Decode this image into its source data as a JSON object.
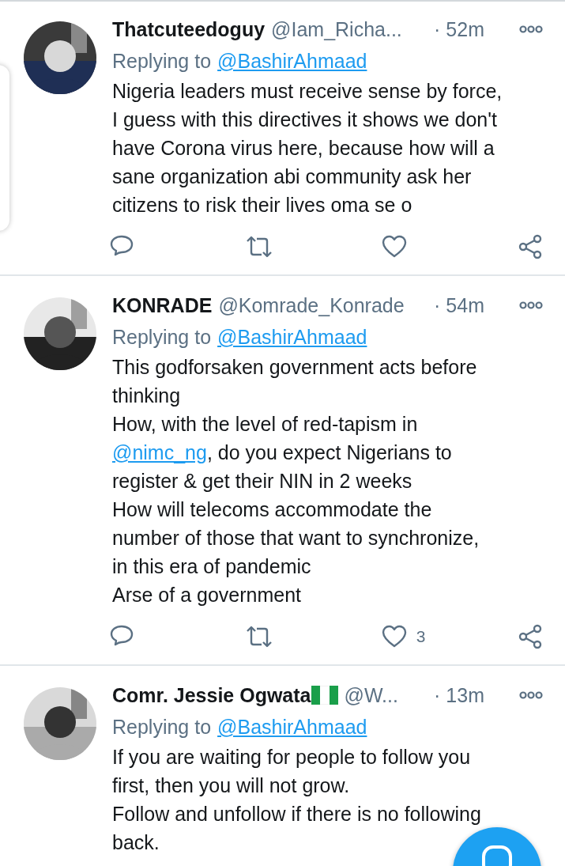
{
  "tweets": [
    {
      "name": "Thatcuteedoguy",
      "flag": false,
      "handle": "@Iam_Richa...",
      "time": "· 52m",
      "replying_label": "Replying to",
      "replying_to": "@BashirAhmaad",
      "lines": [
        [
          {
            "text": "Nigeria leaders must receive sense by force,",
            "link": false
          }
        ],
        [
          {
            "text": "I guess with this directives it shows we don't",
            "link": false
          }
        ],
        [
          {
            "text": "have Corona virus here, because how will a",
            "link": false
          }
        ],
        [
          {
            "text": "sane organization abi community ask her",
            "link": false
          }
        ],
        [
          {
            "text": "citizens to risk their lives oma se o",
            "link": false
          }
        ]
      ]
    },
    {
      "name": "KONRADE",
      "flag": false,
      "handle": "@Komrade_Konrade",
      "time": "· 54m",
      "replying_label": "Replying to",
      "replying_to": "@BashirAhmaad",
      "lines": [
        [
          {
            "text": "This godforsaken government acts before",
            "link": false
          }
        ],
        [
          {
            "text": "thinking",
            "link": false
          }
        ],
        [
          {
            "text": "How, with the level of red-tapism in",
            "link": false
          }
        ],
        [
          {
            "text": "@nimc_ng",
            "link": true
          },
          {
            "text": ", do you expect Nigerians to",
            "link": false
          }
        ],
        [
          {
            "text": "register & get their NIN in 2 weeks",
            "link": false
          }
        ],
        [
          {
            "text": "How will telecoms accommodate the",
            "link": false
          }
        ],
        [
          {
            "text": "number of those that want to synchronize,",
            "link": false
          }
        ],
        [
          {
            "text": "in this era of pandemic",
            "link": false
          }
        ],
        [
          {
            "text": "Arse of a government",
            "link": false
          }
        ]
      ],
      "likes": "3"
    },
    {
      "name": "Comr. Jessie Ogwata",
      "flag": true,
      "handle": "@W...",
      "time": "· 13m",
      "replying_label": "Replying to",
      "replying_to": "@BashirAhmaad",
      "lines": [
        [
          {
            "text": "If you are waiting for people to follow you",
            "link": false
          }
        ],
        [
          {
            "text": "first, then you will not grow.",
            "link": false
          }
        ],
        [
          {
            "text": "Follow and unfollow if there is no following",
            "link": false
          }
        ],
        [
          {
            "text": "back.",
            "link": false
          }
        ]
      ]
    }
  ]
}
